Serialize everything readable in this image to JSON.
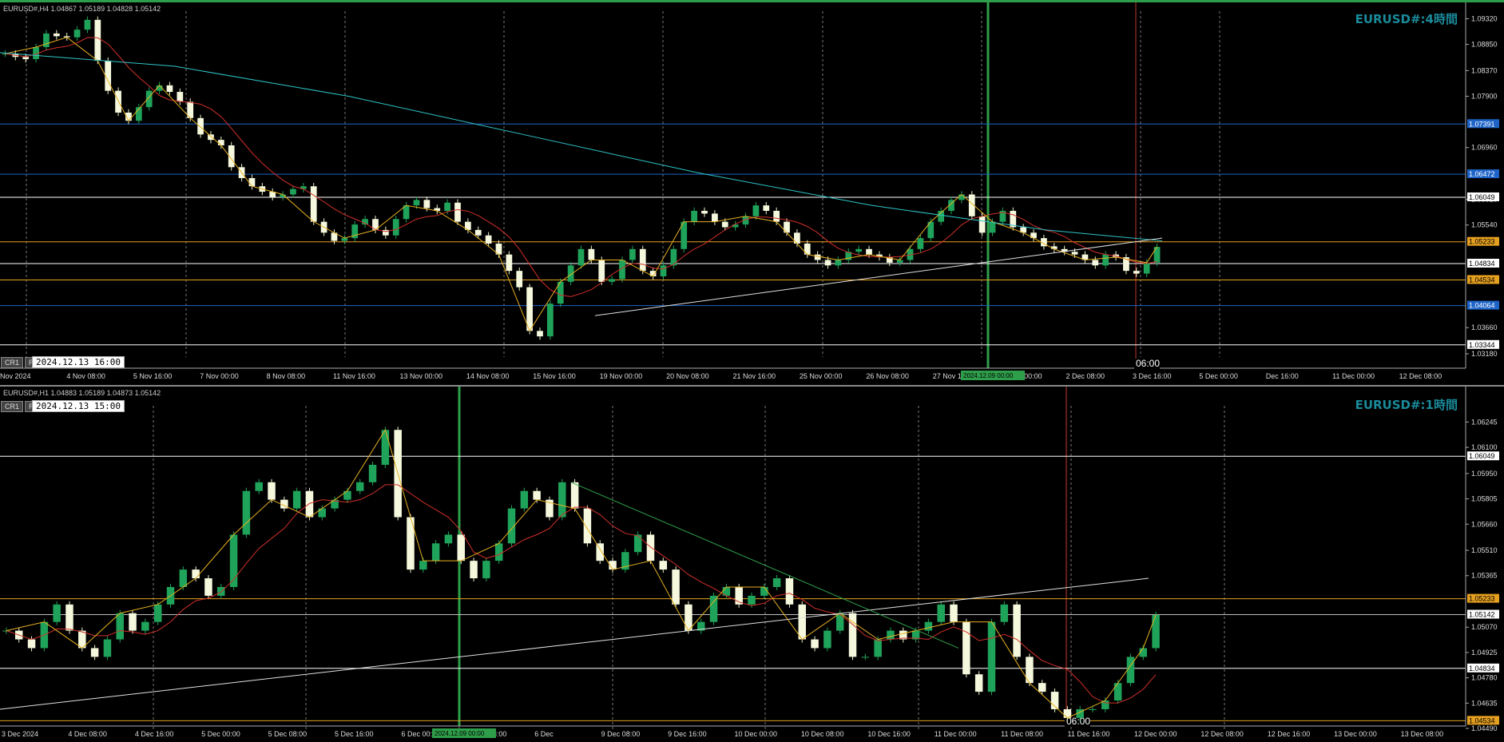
{
  "top_chart": {
    "info": "EURUSD#,H4  1.04867 1.05189 1.04828 1.05142",
    "title": "EURUSD#:4時間",
    "cr": [
      "CR1",
      "R"
    ],
    "datetime": "2024.12.13 16:00",
    "cursor_time": "06:00",
    "highlight_date": "2024.12.09 00:00",
    "price_ticks": [
      "1.09320",
      "1.08850",
      "1.08370",
      "1.07900",
      "1.06960",
      "1.06010",
      "1.05540",
      "1.03660",
      "1.03180"
    ],
    "price_levels": [
      {
        "label": "1.07391",
        "color": "#1e64c8"
      },
      {
        "label": "1.06472",
        "color": "#1e64c8"
      },
      {
        "label": "1.06049",
        "color": "#ffffff"
      },
      {
        "label": "1.05233",
        "color": "#e6a020"
      },
      {
        "label": "1.04834",
        "color": "#ffffff"
      },
      {
        "label": "1.04534",
        "color": "#e6a020"
      },
      {
        "label": "1.04064",
        "color": "#1e64c8"
      },
      {
        "label": "1.03344",
        "color": "#ffffff"
      }
    ],
    "time_labels": [
      "Nov 2024",
      "4 Nov 08:00",
      "5 Nov 16:00",
      "7 Nov 00:00",
      "8 Nov 08:00",
      "11 Nov 16:00",
      "13 Nov 00:00",
      "14 Nov 08:00",
      "15 Nov 16:00",
      "19 Nov 00:00",
      "20 Nov 08:00",
      "21 Nov 16:00",
      "25 Nov 00:00",
      "26 Nov 08:00",
      "27 Nov 16:00",
      "29 Nov 00:00",
      "2 Dec 08:00",
      "3 Dec 16:00",
      "5 Dec 00:00",
      "Dec 16:00",
      "11 Dec 00:00",
      "12 Dec 08:00"
    ],
    "candles": [
      1.0868,
      1.0862,
      1.0858,
      1.088,
      1.0905,
      1.09,
      1.0898,
      1.0912,
      1.093,
      1.0855,
      1.08,
      1.076,
      1.0745,
      1.077,
      1.08,
      1.081,
      1.0798,
      1.078,
      1.075,
      1.072,
      1.071,
      1.07,
      1.066,
      1.064,
      1.0625,
      1.0615,
      1.0605,
      1.061,
      1.062,
      1.0625,
      1.056,
      1.054,
      1.0525,
      1.053,
      1.0555,
      1.0565,
      1.0545,
      1.0535,
      1.0565,
      1.059,
      1.06,
      1.0585,
      1.058,
      1.0595,
      1.056,
      1.0545,
      1.0535,
      1.052,
      1.05,
      1.047,
      1.044,
      1.036,
      1.035,
      1.041,
      1.045,
      1.048,
      1.051,
      1.049,
      1.045,
      1.0455,
      1.049,
      1.051,
      1.047,
      1.046,
      1.048,
      1.051,
      1.056,
      1.058,
      1.0575,
      1.056,
      1.055,
      1.0555,
      1.057,
      1.059,
      1.058,
      1.056,
      1.054,
      1.052,
      1.05,
      1.049,
      1.048,
      1.049,
      1.0505,
      1.051,
      1.05,
      1.0495,
      1.0485,
      1.049,
      1.051,
      1.053,
      1.056,
      1.058,
      1.06,
      1.061,
      1.057,
      1.054,
      1.056,
      1.058,
      1.055,
      1.054,
      1.053,
      1.0515,
      1.051,
      1.0505,
      1.05,
      1.049,
      1.048,
      1.05,
      1.0495,
      1.047,
      1.0465,
      1.0485,
      1.0514
    ]
  },
  "bottom_chart": {
    "info": "EURUSD#,H1  1.04883 1.05189 1.04873 1.05142",
    "title": "EURUSD#:1時間",
    "cr": [
      "CR1",
      "R"
    ],
    "datetime": "2024.12.13 15:00",
    "cursor_time": "06:00",
    "highlight_date": "2024.12.09 00:00",
    "price_ticks": [
      "1.06245",
      "1.06100",
      "1.05950",
      "1.05805",
      "1.05660",
      "1.05510",
      "1.05365",
      "1.05070",
      "1.04925",
      "1.04780",
      "1.04635",
      "1.04490"
    ],
    "price_levels": [
      {
        "label": "1.06049",
        "color": "#ffffff"
      },
      {
        "label": "1.05233",
        "color": "#e6a020"
      },
      {
        "label": "1.05142",
        "color": "#c0c0c0"
      },
      {
        "label": "1.04834",
        "color": "#ffffff"
      },
      {
        "label": "1.04534",
        "color": "#e6a020"
      }
    ],
    "time_labels": [
      "3 Dec 2024",
      "4 Dec 08:00",
      "4 Dec 16:00",
      "5 Dec 00:00",
      "5 Dec 08:00",
      "5 Dec 16:00",
      "6 Dec 00:00",
      "6 Dec 08:00",
      "6 Dec",
      "9 Dec 08:00",
      "9 Dec 16:00",
      "10 Dec 00:00",
      "10 Dec 08:00",
      "10 Dec 16:00",
      "11 Dec 00:00",
      "11 Dec 08:00",
      "11 Dec 16:00",
      "12 Dec 00:00",
      "12 Dec 08:00",
      "12 Dec 16:00",
      "13 Dec 00:00",
      "13 Dec 08:00"
    ],
    "candles": [
      1.0505,
      1.05,
      1.0495,
      1.051,
      1.052,
      1.0505,
      1.0495,
      1.049,
      1.05,
      1.0515,
      1.0505,
      1.051,
      1.052,
      1.053,
      1.054,
      1.0535,
      1.0525,
      1.053,
      1.056,
      1.0585,
      1.059,
      1.058,
      1.0575,
      1.0585,
      1.057,
      1.0575,
      1.058,
      1.0585,
      1.059,
      1.06,
      1.062,
      1.057,
      1.054,
      1.0545,
      1.0555,
      1.056,
      1.0545,
      1.0535,
      1.0545,
      1.0555,
      1.0575,
      1.0585,
      1.058,
      1.057,
      1.059,
      1.0575,
      1.0555,
      1.0545,
      1.054,
      1.055,
      1.056,
      1.0545,
      1.054,
      1.052,
      1.0505,
      1.051,
      1.0525,
      1.053,
      1.052,
      1.0525,
      1.053,
      1.0535,
      1.052,
      1.05,
      1.0495,
      1.0505,
      1.0515,
      1.049,
      1.049,
      1.05,
      1.0505,
      1.05,
      1.0505,
      1.051,
      1.052,
      1.051,
      1.048,
      1.047,
      1.051,
      1.052,
      1.049,
      1.0475,
      1.047,
      1.046,
      1.0455,
      1.046,
      1.046,
      1.0465,
      1.0475,
      1.049,
      1.0495,
      1.0514
    ]
  },
  "chart_data": [
    {
      "type": "line",
      "title": "EURUSD#:4時間",
      "xlabel": "",
      "ylabel": "",
      "ylim": [
        1.0318,
        1.094
      ],
      "x": [
        "Nov 2024",
        "4 Nov 08:00",
        "5 Nov 16:00",
        "7 Nov 00:00",
        "8 Nov 08:00",
        "11 Nov 16:00",
        "13 Nov 00:00",
        "14 Nov 08:00",
        "15 Nov 16:00",
        "19 Nov 00:00",
        "20 Nov 08:00",
        "21 Nov 16:00",
        "25 Nov 00:00",
        "26 Nov 08:00",
        "27 Nov 16:00",
        "29 Nov 00:00",
        "2 Dec 08:00",
        "3 Dec 16:00",
        "5 Dec 00:00",
        "Dec 16:00",
        "11 Dec 00:00",
        "12 Dec 08:00"
      ],
      "series": [
        {
          "values": [
            1.0868,
            1.0905,
            1.093,
            1.076,
            1.079,
            1.066,
            1.062,
            1.0525,
            1.059,
            1.058,
            1.054,
            1.044,
            1.041,
            1.048,
            1.056,
            1.0575,
            1.05,
            1.0495,
            1.056,
            1.056,
            1.0495,
            1.0514
          ]
        }
      ]
    },
    {
      "type": "line",
      "title": "EURUSD#:1時間",
      "xlabel": "",
      "ylabel": "",
      "ylim": [
        1.0449,
        1.0632
      ],
      "x": [
        "3 Dec 2024",
        "4 Dec 08:00",
        "4 Dec 16:00",
        "5 Dec 00:00",
        "5 Dec 08:00",
        "5 Dec 16:00",
        "6 Dec 00:00",
        "6 Dec 08:00",
        "6 Dec",
        "9 Dec 08:00",
        "9 Dec 16:00",
        "10 Dec 00:00",
        "10 Dec 08:00",
        "10 Dec 16:00",
        "11 Dec 00:00",
        "11 Dec 08:00",
        "11 Dec 16:00",
        "12 Dec 00:00",
        "12 Dec 08:00",
        "12 Dec 16:00",
        "13 Dec 00:00",
        "13 Dec 08:00"
      ],
      "series": [
        {
          "values": [
            1.0505,
            1.051,
            1.052,
            1.0505,
            1.054,
            1.0585,
            1.058,
            1.06,
            1.0545,
            1.0575,
            1.058,
            1.0545,
            1.052,
            1.0505,
            1.049,
            1.0505,
            1.052,
            1.048,
            1.049,
            1.047,
            1.046,
            1.0514
          ]
        }
      ]
    }
  ]
}
